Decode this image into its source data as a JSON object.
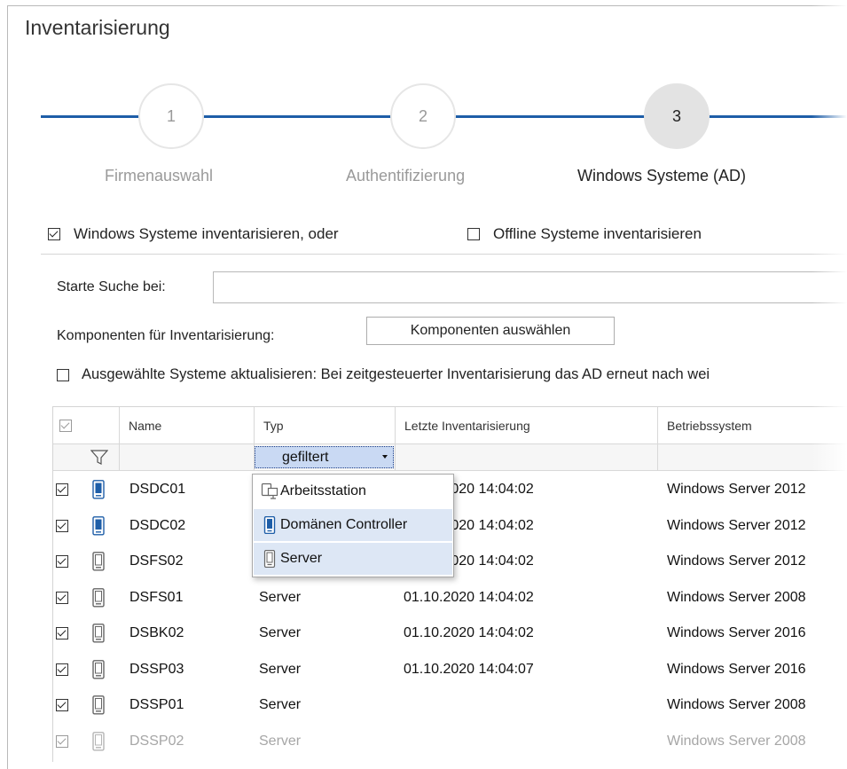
{
  "window": {
    "title": "Inventarisierung"
  },
  "stepper": {
    "steps": [
      {
        "number": "1",
        "label": "Firmenauswahl",
        "active": false
      },
      {
        "number": "2",
        "label": "Authentifizierung",
        "active": false
      },
      {
        "number": "3",
        "label": "Windows Systeme (AD)",
        "active": true
      }
    ],
    "line_color": "#1e5ea8"
  },
  "options": {
    "inventory_windows": {
      "label": "Windows Systeme inventarisieren, oder",
      "checked": true
    },
    "inventory_offline": {
      "label": "Offline Systeme inventarisieren",
      "checked": false
    }
  },
  "search": {
    "label": "Starte Suche bei:",
    "value": ""
  },
  "components": {
    "label": "Komponenten für Inventarisierung:",
    "button_label": "Komponenten auswählen"
  },
  "update_selected": {
    "label": "Ausgewählte Systeme aktualisieren: Bei zeitgesteuerter Inventarisierung das AD erneut nach wei",
    "checked": false
  },
  "grid": {
    "columns": [
      "Name",
      "Typ",
      "Letzte Inventarisierung",
      "Betriebssystem"
    ],
    "type_filter": {
      "value": "gefiltert"
    },
    "rows": [
      {
        "checked": true,
        "icon": "device-icon-blue",
        "name": "DSDC01",
        "type": "",
        "last": "01.10.2020 14:04:02",
        "os": "Windows Server 2012"
      },
      {
        "checked": true,
        "icon": "device-icon-blue",
        "name": "DSDC02",
        "type": "",
        "last": "01.10.2020 14:04:02",
        "os": "Windows Server 2012"
      },
      {
        "checked": true,
        "icon": "device-icon-gray",
        "name": "DSFS02",
        "type": "",
        "last": "01.10.2020 14:04:02",
        "os": "Windows Server 2012"
      },
      {
        "checked": true,
        "icon": "device-icon-gray",
        "name": "DSFS01",
        "type": "Server",
        "last": "01.10.2020 14:04:02",
        "os": "Windows Server 2008"
      },
      {
        "checked": true,
        "icon": "device-icon-gray",
        "name": "DSBK02",
        "type": "Server",
        "last": "01.10.2020 14:04:02",
        "os": "Windows Server 2016"
      },
      {
        "checked": true,
        "icon": "device-icon-gray",
        "name": "DSSP03",
        "type": "Server",
        "last": "01.10.2020 14:04:07",
        "os": "Windows Server 2016"
      },
      {
        "checked": true,
        "icon": "device-icon-gray",
        "name": "DSSP01",
        "type": "Server",
        "last": "",
        "os": "Windows Server 2008"
      },
      {
        "checked": true,
        "icon": "device-icon-gray",
        "name": "DSSP02",
        "type": "Server",
        "last": "",
        "os": "Windows Server 2008"
      }
    ]
  },
  "type_dropdown": {
    "items": [
      {
        "label": "Arbeitsstation",
        "icon": "workstation-icon"
      },
      {
        "label": "Domänen Controller",
        "icon": "domain-controller-icon"
      },
      {
        "label": "Server",
        "icon": "server-icon"
      }
    ]
  },
  "colors": {
    "accent": "#1e5ea8",
    "selection": "#c9d9f3",
    "hover": "#dde7f5"
  }
}
